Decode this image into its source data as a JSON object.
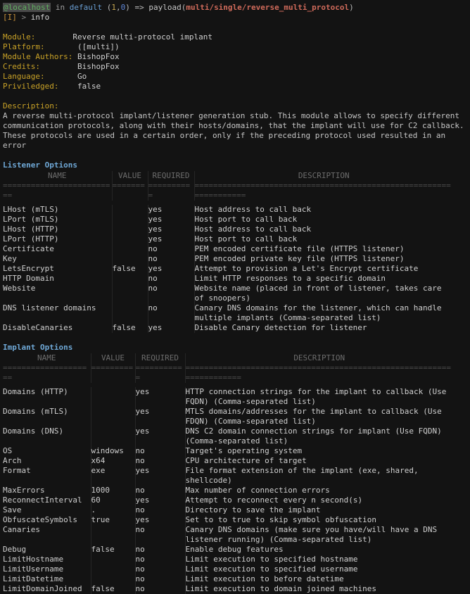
{
  "prompt": {
    "host": "@localhost",
    "in_word": "in",
    "workspace": "default",
    "open_paren": "(",
    "num_a": "1",
    "comma": ",",
    "num_b": "0",
    "close_paren": ")",
    "arrow": "=>",
    "cmd_word": "payload",
    "payload_open": "(",
    "payload_path": "multi/single/reverse_multi_protocol",
    "payload_close": ")",
    "tag": "[I]",
    "gt": ">",
    "command": "info"
  },
  "info": {
    "rows": [
      {
        "label": "Module:",
        "value": "Reverse multi-protocol implant"
      },
      {
        "label": "Platform:",
        "value": " ([multi])"
      },
      {
        "label": "Module Authors:",
        "value": "BishopFox"
      },
      {
        "label": "Credits:",
        "value": "BishopFox"
      },
      {
        "label": "Language:",
        "value": "Go"
      },
      {
        "label": "Priviledged:",
        "value": "false"
      }
    ]
  },
  "description": {
    "label": "Description:",
    "lines": [
      "A reverse multi-protocol implant/listener generation stub. This module allows to specify different",
      "communication protocols, along with their hosts/domains, that the implant will use for C2 callback.",
      "These protocols are used in a certain order, only if the preceding protocol used resulted in an",
      "error"
    ]
  },
  "columns": {
    "name": "NAME",
    "value": "VALUE",
    "required": "REQUIRED",
    "description": "DESCRIPTION"
  },
  "separators": {
    "name_listener": "=========================",
    "value_listener": "=======",
    "required_listener": "==========",
    "description_listener": "==================================================================",
    "name_implant": "====================",
    "value_implant": "=========",
    "required_implant": "===========",
    "description_implant": "====================================================================="
  },
  "listener_options": {
    "title": "Listener Options",
    "rows": [
      {
        "name": "LHost (mTLS)",
        "value": "",
        "required": "yes",
        "description": "Host address to call back"
      },
      {
        "name": "LPort (mTLS)",
        "value": "",
        "required": "yes",
        "description": "Host port to call back"
      },
      {
        "name": "LHost (HTTP)",
        "value": "",
        "required": "yes",
        "description": "Host address to call back"
      },
      {
        "name": "LPort (HTTP)",
        "value": "",
        "required": "yes",
        "description": "Host port to call back"
      },
      {
        "name": "Certificate",
        "value": "",
        "required": "no",
        "description": "PEM encoded certificate file (HTTPS listener)"
      },
      {
        "name": "Key",
        "value": "",
        "required": "no",
        "description": "PEM encoded private key file (HTTPS listener)"
      },
      {
        "name": "LetsEncrypt",
        "value": "false",
        "required": "yes",
        "description": "Attempt to provision a Let's Encrypt certificate"
      },
      {
        "name": "HTTP Domain",
        "value": "",
        "required": "no",
        "description": "Limit HTTP responses to a specific domain"
      },
      {
        "name": "Website",
        "value": "",
        "required": "no",
        "description": "Website name (placed in front of listener, takes care of snoopers)"
      },
      {
        "name": "DNS listener domains",
        "value": "",
        "required": "no",
        "description": "Canary DNS domains for the listener, which can handle multiple implants (Comma-separated list)"
      },
      {
        "name": "DisableCanaries",
        "value": "false",
        "required": "yes",
        "description": "Disable Canary detection for listener"
      }
    ]
  },
  "implant_options": {
    "title": "Implant Options",
    "rows": [
      {
        "name": "Domains (HTTP)",
        "value": "",
        "required": "yes",
        "description": "HTTP connection strings for the implant to callback (Use FQDN) (Comma-separated list)"
      },
      {
        "name": "Domains (mTLS)",
        "value": "",
        "required": "yes",
        "description": "MTLS domains/addresses for the implant to callback (Use FDQN) (Comma-separated list)"
      },
      {
        "name": "Domains (DNS)",
        "value": "",
        "required": "yes",
        "description": "DNS C2 domain connection strings for implant (Use FQDN) (Comma-separated list)"
      },
      {
        "name": "OS",
        "value": "windows",
        "required": "no",
        "description": "Target's operating system"
      },
      {
        "name": "Arch",
        "value": "x64",
        "required": "no",
        "description": "CPU architecture of target"
      },
      {
        "name": "Format",
        "value": "exe",
        "required": "yes",
        "description": "File format extension of the implant (exe, shared, shellcode)"
      },
      {
        "name": "MaxErrors",
        "value": "1000",
        "required": "no",
        "description": "Max number of connection errors"
      },
      {
        "name": "ReconnectInterval",
        "value": "60",
        "required": "yes",
        "description": "Attempt to reconnect every n second(s)"
      },
      {
        "name": "Save",
        "value": ".",
        "required": "no",
        "description": "Directory to save the implant"
      },
      {
        "name": "ObfuscateSymbols",
        "value": "true",
        "required": "yes",
        "description": "Set to to true to skip symbol obfuscation"
      },
      {
        "name": "Canaries",
        "value": "",
        "required": "no",
        "description": "Canary DNS domains (make sure you have/will have a DNS listener running) (Comma-separated list)"
      },
      {
        "name": "Debug",
        "value": "false",
        "required": "no",
        "description": "Enable debug features"
      },
      {
        "name": "LimitHostname",
        "value": "",
        "required": "no",
        "description": "Limit execution to specified hostname"
      },
      {
        "name": "LimitUsername",
        "value": "",
        "required": "no",
        "description": "Limit execution to specified username"
      },
      {
        "name": "LimitDatetime",
        "value": "",
        "required": "no",
        "description": "Limit execution to before datetime"
      },
      {
        "name": "LimitDomainJoined",
        "value": "false",
        "required": "no",
        "description": "Limit execution to domain joined machines"
      }
    ]
  }
}
